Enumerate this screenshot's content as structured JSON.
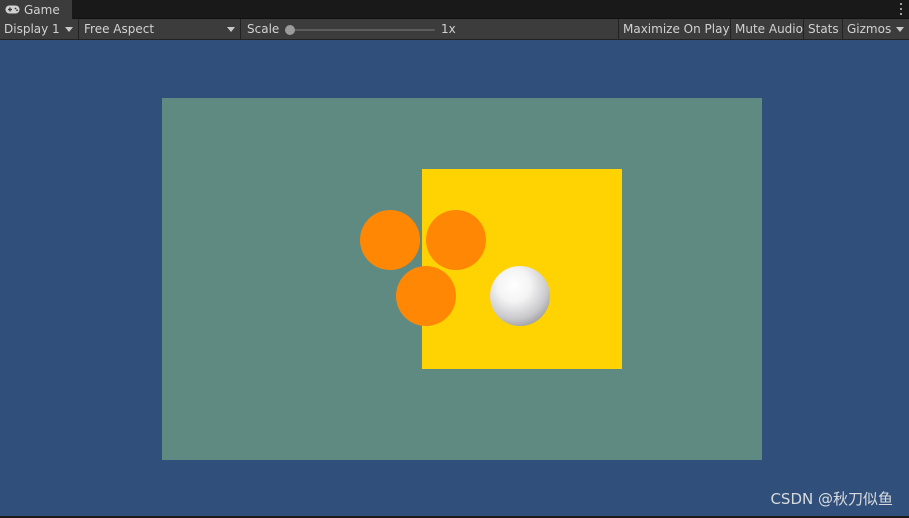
{
  "tab": {
    "title": "Game",
    "icon": "gamepad-icon"
  },
  "toolbar": {
    "display": "Display 1",
    "aspect": "Free Aspect",
    "scale_label": "Scale",
    "scale_value": "1x",
    "scale_level": 0.0,
    "maximize_on_play": "Maximize On Play",
    "mute_audio": "Mute Audio",
    "stats": "Stats",
    "gizmos": "Gizmos"
  },
  "scene": {
    "background_color": "#30507b",
    "ground_color": "#5f8a82",
    "panel_color": "#ffd302",
    "disc_color": "#ff8704",
    "ball_color": "#f2f2f2"
  },
  "watermark": "CSDN @秋刀似鱼"
}
